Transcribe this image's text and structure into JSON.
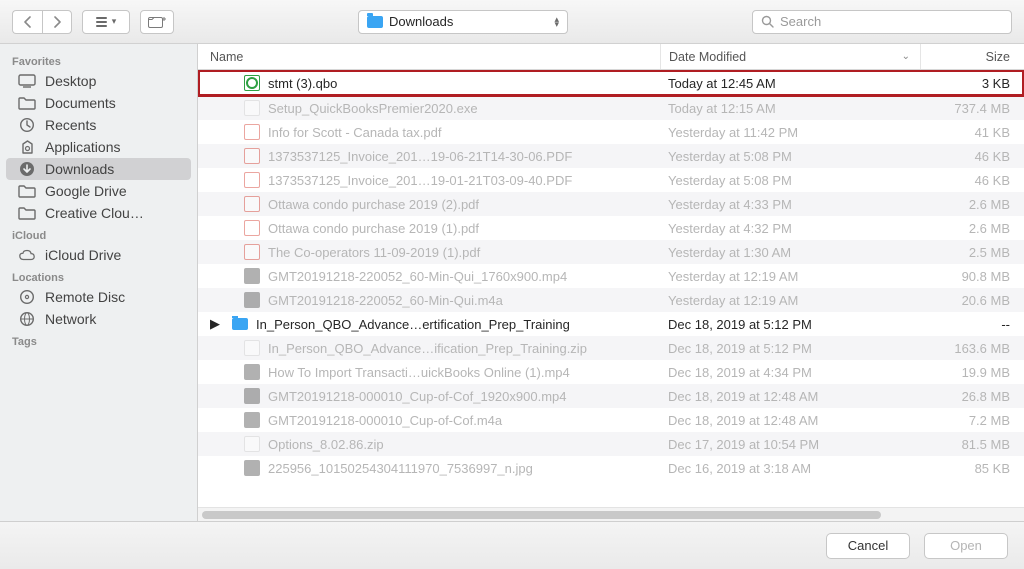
{
  "toolbar": {
    "path_label": "Downloads",
    "search_placeholder": "Search"
  },
  "sidebar": {
    "sections": [
      {
        "title": "Favorites",
        "items": [
          {
            "label": "Desktop",
            "icon": "desktop"
          },
          {
            "label": "Documents",
            "icon": "folder"
          },
          {
            "label": "Recents",
            "icon": "clock"
          },
          {
            "label": "Applications",
            "icon": "apps"
          },
          {
            "label": "Downloads",
            "icon": "download",
            "selected": true
          },
          {
            "label": "Google Drive",
            "icon": "folder"
          },
          {
            "label": "Creative Clou…",
            "icon": "folder"
          }
        ]
      },
      {
        "title": "iCloud",
        "items": [
          {
            "label": "iCloud Drive",
            "icon": "cloud"
          }
        ]
      },
      {
        "title": "Locations",
        "items": [
          {
            "label": "Remote Disc",
            "icon": "disc"
          },
          {
            "label": "Network",
            "icon": "globe"
          }
        ]
      },
      {
        "title": "Tags",
        "items": []
      }
    ]
  },
  "columns": {
    "name": "Name",
    "date": "Date Modified",
    "size": "Size"
  },
  "files": [
    {
      "name": "stmt (3).qbo",
      "date": "Today at 12:45 AM",
      "size": "3 KB",
      "type": "qbo",
      "highlight": true
    },
    {
      "name": "Setup_QuickBooksPremier2020.exe",
      "date": "Today at 12:15 AM",
      "size": "737.4 MB",
      "type": "exe",
      "dim": true
    },
    {
      "name": "Info for Scott - Canada tax.pdf",
      "date": "Yesterday at 11:42 PM",
      "size": "41 KB",
      "type": "pdf",
      "dim": true
    },
    {
      "name": "1373537125_Invoice_201…19-06-21T14-30-06.PDF",
      "date": "Yesterday at 5:08 PM",
      "size": "46 KB",
      "type": "pdf",
      "dim": true
    },
    {
      "name": "1373537125_Invoice_201…19-01-21T03-09-40.PDF",
      "date": "Yesterday at 5:08 PM",
      "size": "46 KB",
      "type": "pdf",
      "dim": true
    },
    {
      "name": "Ottawa condo purchase 2019 (2).pdf",
      "date": "Yesterday at 4:33 PM",
      "size": "2.6 MB",
      "type": "pdf",
      "dim": true
    },
    {
      "name": "Ottawa condo purchase 2019 (1).pdf",
      "date": "Yesterday at 4:32 PM",
      "size": "2.6 MB",
      "type": "pdf",
      "dim": true
    },
    {
      "name": "The Co-operators 11-09-2019 (1).pdf",
      "date": "Yesterday at 1:30 AM",
      "size": "2.5 MB",
      "type": "pdf",
      "dim": true
    },
    {
      "name": "GMT20191218-220052_60-Min-Qui_1760x900.mp4",
      "date": "Yesterday at 12:19 AM",
      "size": "90.8 MB",
      "type": "mov",
      "dim": true
    },
    {
      "name": "GMT20191218-220052_60-Min-Qui.m4a",
      "date": "Yesterday at 12:19 AM",
      "size": "20.6 MB",
      "type": "mov",
      "dim": true
    },
    {
      "name": "In_Person_QBO_Advance…ertification_Prep_Training",
      "date": "Dec 18, 2019 at 5:12 PM",
      "size": "--",
      "type": "folder",
      "disclosure": true
    },
    {
      "name": "In_Person_QBO_Advance…ification_Prep_Training.zip",
      "date": "Dec 18, 2019 at 5:12 PM",
      "size": "163.6 MB",
      "type": "zip",
      "dim": true
    },
    {
      "name": "How To Import Transacti…uickBooks Online (1).mp4",
      "date": "Dec 18, 2019 at 4:34 PM",
      "size": "19.9 MB",
      "type": "mov",
      "dim": true
    },
    {
      "name": "GMT20191218-000010_Cup-of-Cof_1920x900.mp4",
      "date": "Dec 18, 2019 at 12:48 AM",
      "size": "26.8 MB",
      "type": "mov",
      "dim": true
    },
    {
      "name": "GMT20191218-000010_Cup-of-Cof.m4a",
      "date": "Dec 18, 2019 at 12:48 AM",
      "size": "7.2 MB",
      "type": "mov",
      "dim": true
    },
    {
      "name": "Options_8.02.86.zip",
      "date": "Dec 17, 2019 at 10:54 PM",
      "size": "81.5 MB",
      "type": "zip",
      "dim": true
    },
    {
      "name": "225956_10150254304111970_7536997_n.jpg",
      "date": "Dec 16, 2019 at 3:18 AM",
      "size": "85 KB",
      "type": "mov",
      "dim": true
    }
  ],
  "buttons": {
    "cancel": "Cancel",
    "open": "Open"
  }
}
